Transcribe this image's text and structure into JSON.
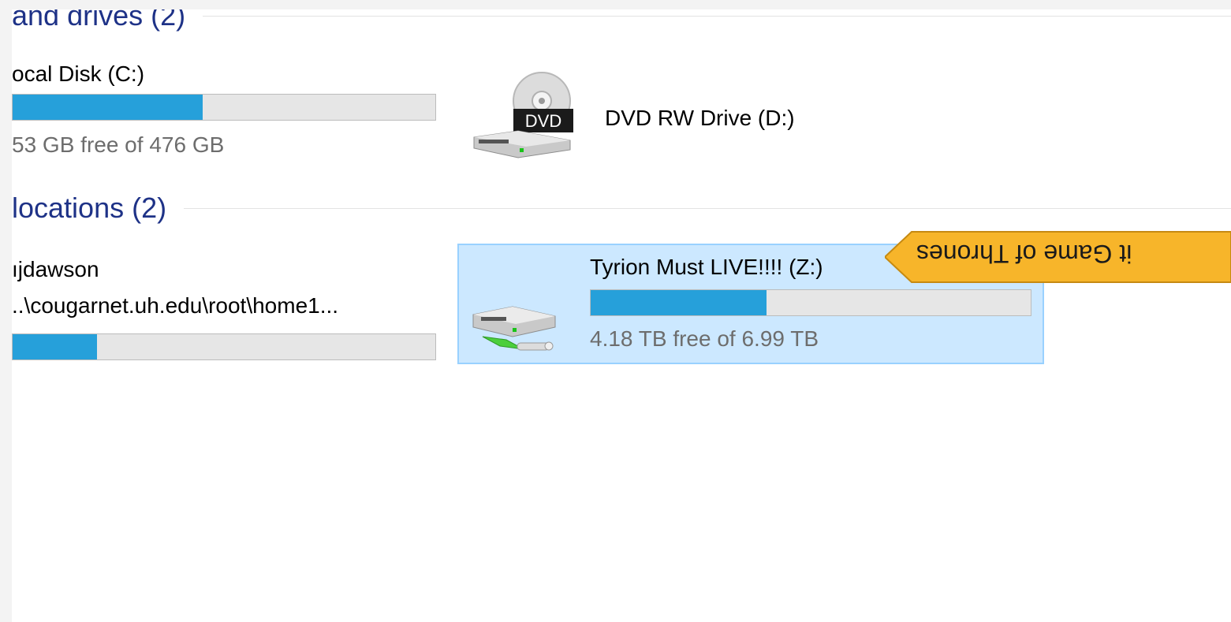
{
  "groups": {
    "devices": {
      "header": "and drives (2)"
    },
    "network": {
      "header": "locations (2)"
    }
  },
  "drives": {
    "c": {
      "name": "ocal Disk (C:)",
      "free_text": "53 GB free of 476 GB",
      "used_fraction": 0.45
    },
    "d": {
      "name": "DVD RW Drive (D:)",
      "icon_label": "DVD",
      "icon": "dvd-drive-icon"
    }
  },
  "network": {
    "user": {
      "name": "ıjdawson",
      "path": "..\\cougarnet.uh.edu\\root\\home1...",
      "used_fraction": 0.2
    },
    "z": {
      "name": "Tyrion Must LIVE!!!! (Z:)",
      "free_text": "4.18 TB free of 6.99 TB",
      "used_fraction": 0.4,
      "icon": "network-drive-icon"
    }
  },
  "tooltip": {
    "text": "it Game of Thrones"
  },
  "colors": {
    "accent": "#26a0da",
    "selection": "#cce8ff",
    "tooltip": "#f7b52a"
  }
}
